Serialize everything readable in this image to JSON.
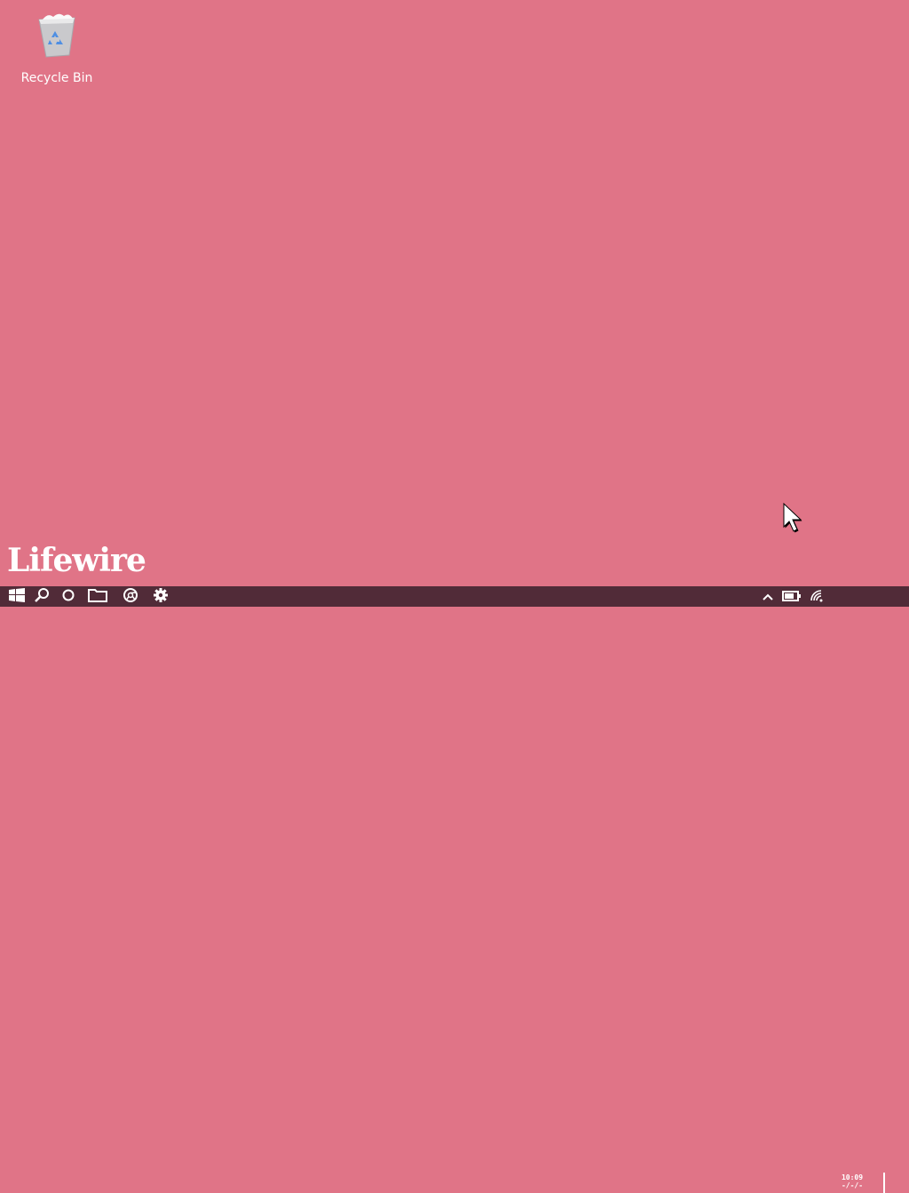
{
  "desktop": {
    "background_color": "#e07487",
    "icons": [
      {
        "label": "Recycle Bin",
        "icon": "recycle-bin-icon"
      }
    ],
    "watermark": "Lifewire"
  },
  "taskbar": {
    "background_color": "#512b38",
    "left_buttons": [
      {
        "name": "start-button",
        "icon": "windows-logo-icon"
      },
      {
        "name": "search-button",
        "icon": "search-icon"
      },
      {
        "name": "cortana-button",
        "icon": "circle-icon"
      },
      {
        "name": "file-explorer-button",
        "icon": "folder-icon"
      },
      {
        "name": "browser-button",
        "icon": "chrome-icon"
      },
      {
        "name": "settings-button",
        "icon": "gear-icon"
      }
    ],
    "tray": {
      "overflow_icon": "chevron-up-icon",
      "battery_icon": "battery-icon",
      "network_icon": "wifi-icon",
      "time": "10:09",
      "date": "-/-/-"
    }
  }
}
